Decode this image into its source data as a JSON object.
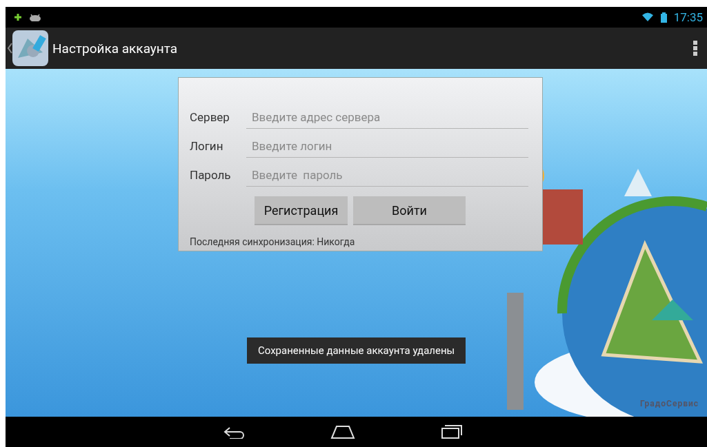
{
  "status_bar": {
    "time": "17:35"
  },
  "action_bar": {
    "title": "Настройка аккаунта"
  },
  "form": {
    "fields": [
      {
        "label": "Сервер",
        "placeholder": "Введите адрес сервера"
      },
      {
        "label": "Логин",
        "placeholder": "Введите логин"
      },
      {
        "label": "Пароль",
        "placeholder": "Введите  пароль"
      }
    ],
    "buttons": [
      "Регистрация",
      "Войти"
    ],
    "sync": "Последняя синхронизация:  Никогда"
  },
  "toast": "Сохраненные данные аккаунта удалены",
  "logo": "ГрадоСервис"
}
